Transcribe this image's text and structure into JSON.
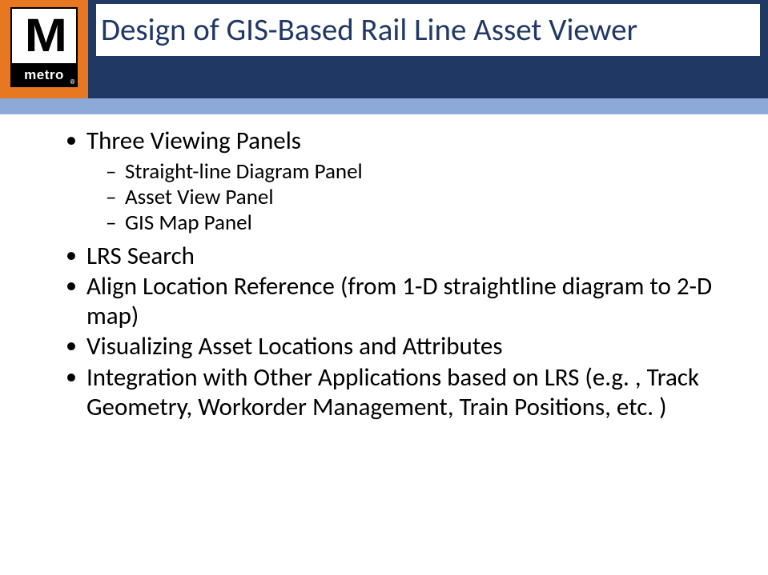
{
  "logo": {
    "letter": "M",
    "word": "metro",
    "registered": "®"
  },
  "title": "Design of GIS-Based Rail Line Asset Viewer",
  "bullets": [
    {
      "text": "Three Viewing Panels",
      "sub": [
        "Straight-line Diagram Panel",
        "Asset View Panel",
        "GIS Map Panel"
      ]
    },
    {
      "text": "LRS Search"
    },
    {
      "text": "Align Location Reference (from 1-D straightline diagram to 2-D map)"
    },
    {
      "text": "Visualizing Asset Locations and Attributes"
    },
    {
      "text": "Integration with Other Applications based on LRS (e.g. , Track Geometry, Workorder Management, Train Positions, etc. )"
    }
  ]
}
